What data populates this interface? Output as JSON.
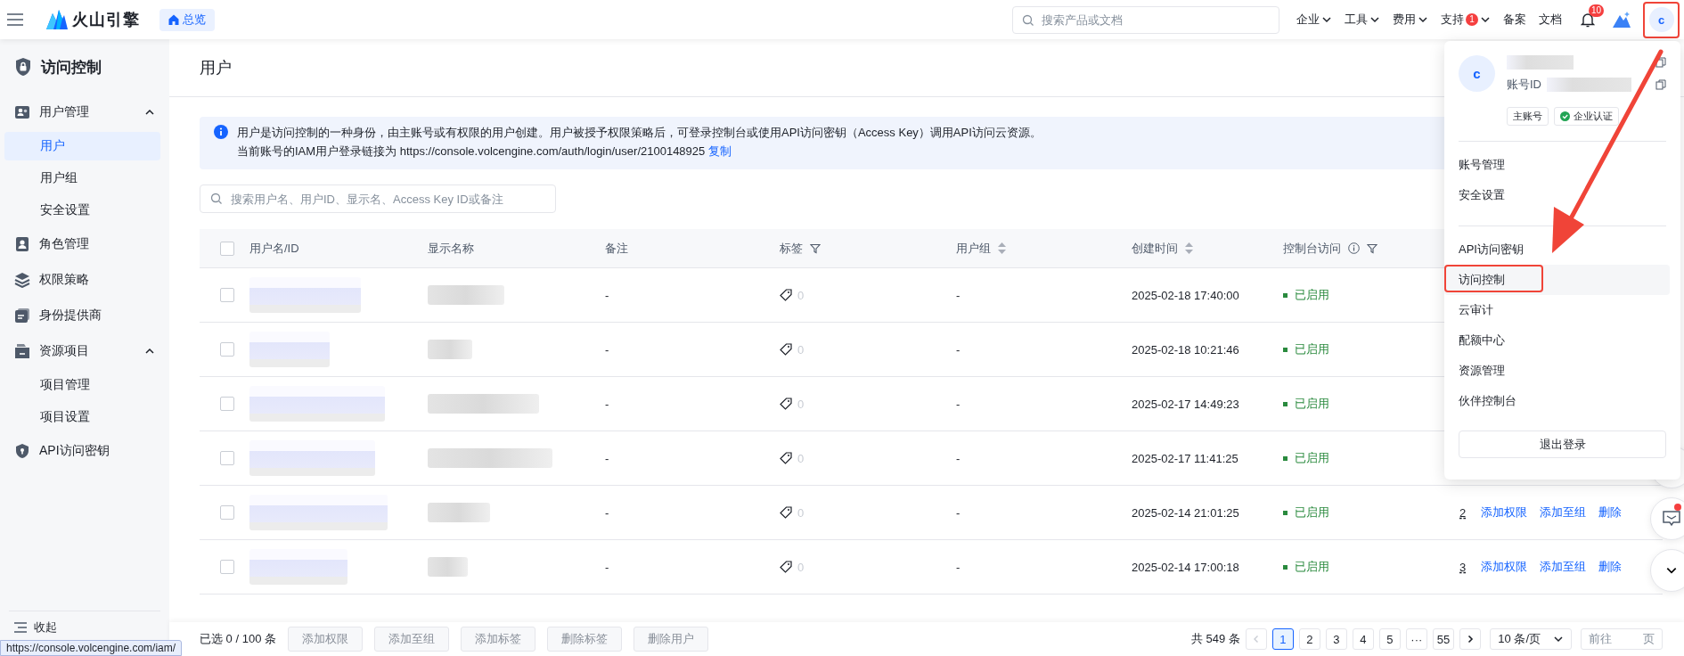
{
  "header": {
    "logo_text": "火山引擎",
    "overview": "总览",
    "search": {
      "placeholder": "搜索产品或文档"
    },
    "nav": [
      {
        "label": "企业",
        "dropdown": true
      },
      {
        "label": "工具",
        "dropdown": true
      },
      {
        "label": "费用",
        "dropdown": true
      },
      {
        "label": "支持",
        "badge": "1",
        "dropdown": true
      },
      {
        "label": "备案",
        "dropdown": false
      },
      {
        "label": "文档",
        "dropdown": false
      }
    ],
    "notifications": {
      "badge": "10"
    },
    "avatar": {
      "initial": "c",
      "marked": true
    }
  },
  "sidebar": {
    "title": "访问控制",
    "items": [
      {
        "label": "用户管理",
        "selected": false,
        "expanded": true,
        "children": [
          {
            "label": "用户",
            "selected": true
          },
          {
            "label": "用户组",
            "selected": false
          },
          {
            "label": "安全设置",
            "selected": false
          }
        ]
      },
      {
        "label": "角色管理",
        "selected": false
      },
      {
        "label": "权限策略",
        "selected": false
      },
      {
        "label": "身份提供商",
        "selected": false
      },
      {
        "label": "资源项目",
        "selected": false,
        "expanded": true,
        "children": [
          {
            "label": "项目管理",
            "selected": false
          },
          {
            "label": "项目设置",
            "selected": false
          }
        ]
      },
      {
        "label": "API访问密钥",
        "selected": false
      }
    ],
    "collapse": "收起"
  },
  "page": {
    "title": "用户",
    "notice": {
      "line_1": "用户是访问控制的一种身份，由主账号或有权限的用户创建。用户被授予权限策略后，可登录控制台或使用API访问密钥（Access Key）调用API访问云资源。",
      "line_2": "当前账号的IAM用户登录链接为 https://console.volcengine.com/auth/login/user/2100148925",
      "copy_link": "复制"
    },
    "search": {
      "placeholder": "搜索用户名、用户ID、显示名、Access Key ID或备注"
    },
    "table": {
      "header_checked": false,
      "columns": [
        {
          "label": "用户名/ID",
          "sort": false,
          "filter": false,
          "info": false
        },
        {
          "label": "显示名称",
          "sort": false,
          "filter": false,
          "info": false
        },
        {
          "label": "备注",
          "sort": false,
          "filter": false,
          "info": false
        },
        {
          "label": "标签",
          "sort": false,
          "filter": true,
          "info": false
        },
        {
          "label": "用户组",
          "sort": true,
          "filter": false,
          "info": false
        },
        {
          "label": "创建时间",
          "sort": true,
          "filter": false,
          "info": false
        },
        {
          "label": "控制台访问",
          "sort": false,
          "filter": true,
          "info": true
        }
      ],
      "rows": [
        {
          "selected": false,
          "remark": "-",
          "tags": "0",
          "group": "-",
          "created": "2025-02-18 17:40:00",
          "console_access": "已启用"
        },
        {
          "selected": false,
          "remark": "-",
          "tags": "0",
          "group": "-",
          "created": "2025-02-18 10:21:46",
          "console_access": "已启用"
        },
        {
          "selected": false,
          "remark": "-",
          "tags": "0",
          "group": "-",
          "created": "2025-02-17 14:49:23",
          "console_access": "已启用"
        },
        {
          "selected": false,
          "remark": "-",
          "tags": "0",
          "group": "-",
          "created": "2025-02-17 11:41:25",
          "console_access": "已启用"
        },
        {
          "selected": false,
          "remark": "-",
          "tags": "0",
          "group": "-",
          "created": "2025-02-14 21:01:25",
          "console_access": "已启用",
          "column_9": "2",
          "actions": [
            "添加权限",
            "添加至组",
            "删除"
          ]
        },
        {
          "selected": false,
          "remark": "-",
          "tags": "0",
          "group": "-",
          "created": "2025-02-14 17:00:18",
          "console_access": "已启用",
          "column_9": "3",
          "actions": [
            "添加权限",
            "添加至组",
            "删除"
          ]
        }
      ]
    },
    "selection": {
      "summary": "已选 0 / 100 条",
      "buttons": [
        {
          "label": "添加权限",
          "disabled": true
        },
        {
          "label": "添加至组",
          "disabled": true
        },
        {
          "label": "添加标签",
          "disabled": true
        },
        {
          "label": "删除标签",
          "disabled": true
        },
        {
          "label": "删除用户",
          "disabled": true
        }
      ]
    },
    "pagination": {
      "total": "共 549 条",
      "prev_disabled": true,
      "next_disabled": false,
      "pages": [
        {
          "label": "1",
          "selected": true
        },
        {
          "label": "2",
          "selected": false
        },
        {
          "label": "3",
          "selected": false
        },
        {
          "label": "4",
          "selected": false
        },
        {
          "label": "5",
          "selected": false
        },
        {
          "label": "···",
          "selected": false
        },
        {
          "label": "55",
          "selected": false
        }
      ],
      "page_size": "10 条/页",
      "goto": "前往",
      "goto_suffix": "页"
    }
  },
  "account_menu": {
    "avatar": "c",
    "account_id_label": "账号ID",
    "tags": [
      {
        "label": "主账号",
        "verified": false
      },
      {
        "label": "企业认证",
        "verified": true
      }
    ],
    "groups": [
      [
        {
          "label": "账号管理",
          "hovered": false,
          "marked": false
        },
        {
          "label": "安全设置",
          "hovered": false,
          "marked": false
        }
      ],
      [
        {
          "label": "API访问密钥",
          "hovered": false,
          "marked": false
        },
        {
          "label": "访问控制",
          "hovered": true,
          "marked": true
        },
        {
          "label": "云审计",
          "hovered": false,
          "marked": false
        },
        {
          "label": "配额中心",
          "hovered": false,
          "marked": false
        },
        {
          "label": "资源管理",
          "hovered": false,
          "marked": false
        },
        {
          "label": "伙伴控制台",
          "hovered": false,
          "marked": false
        }
      ]
    ],
    "logout": "退出登录"
  },
  "status_tip": "https://console.volcengine.com/iam/"
}
